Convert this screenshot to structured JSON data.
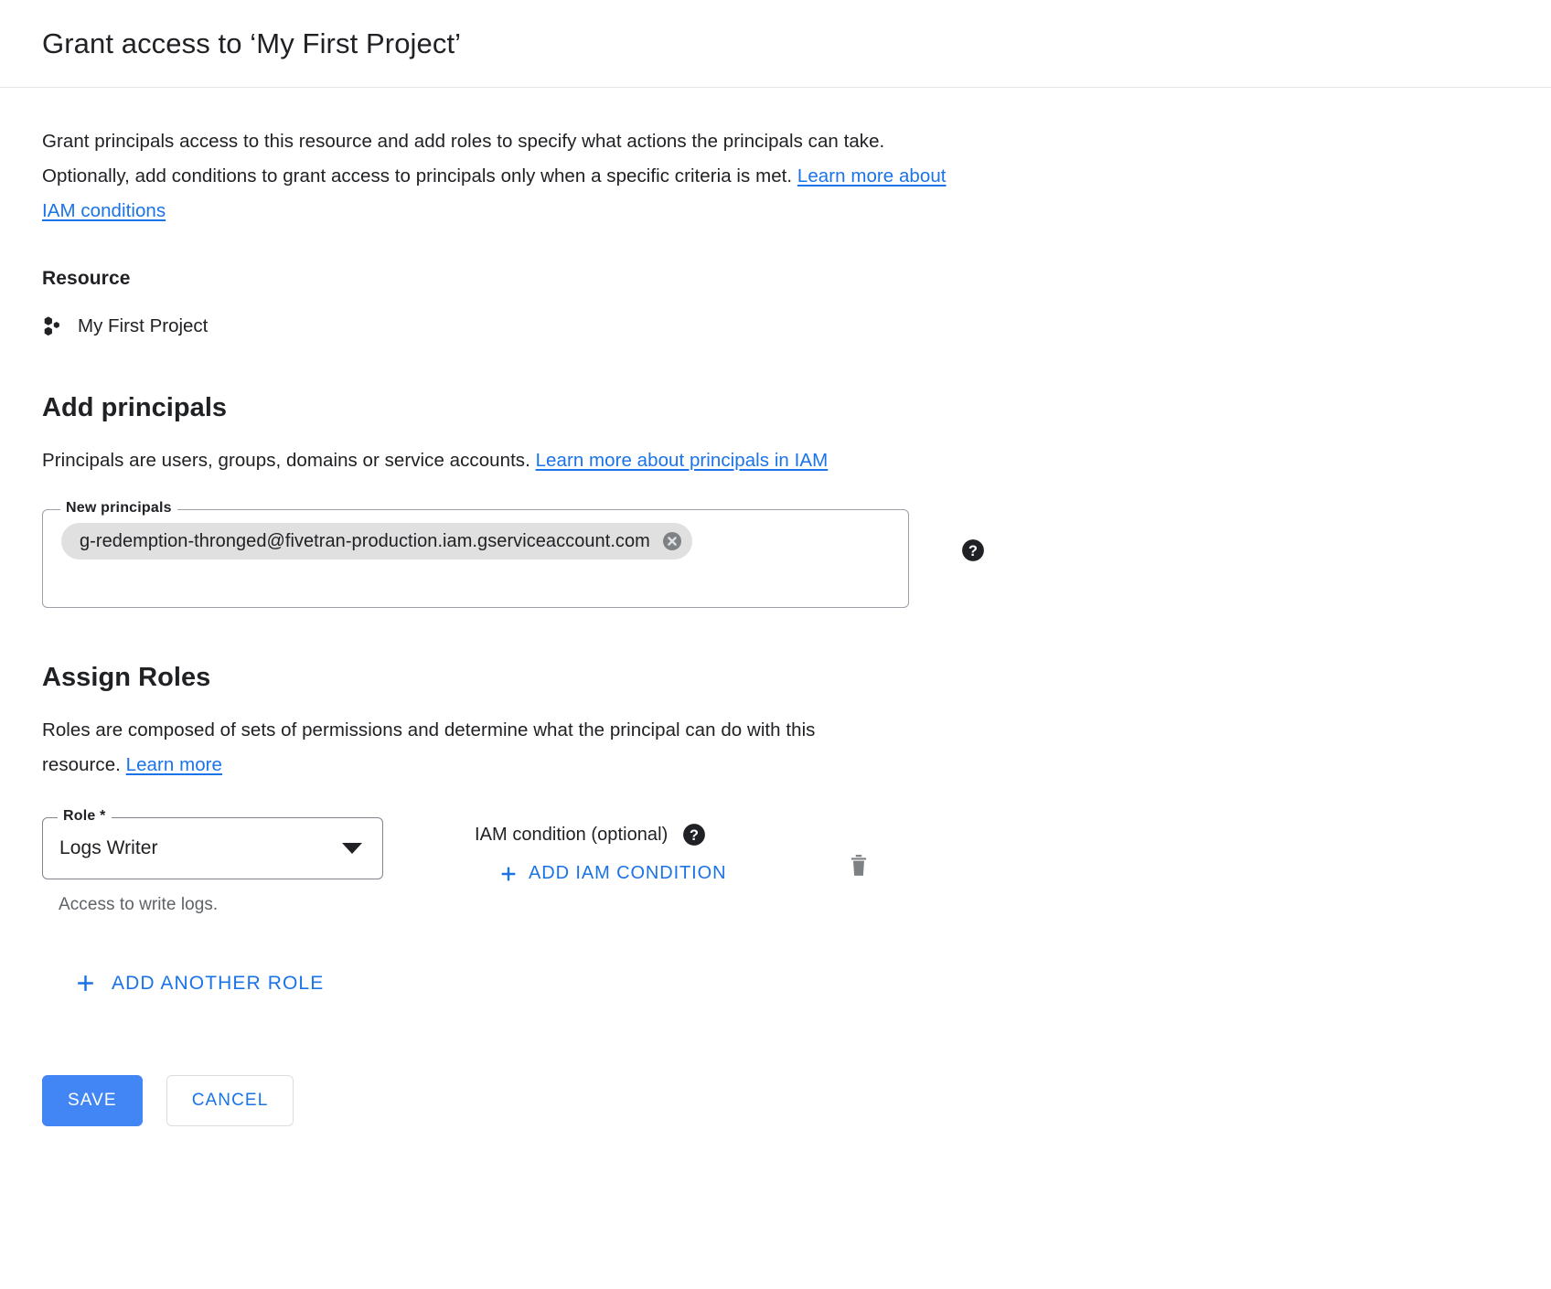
{
  "header": {
    "title": "Grant access to ‘My First Project’"
  },
  "intro": {
    "text": "Grant principals access to this resource and add roles to specify what actions the principals can take. Optionally, add conditions to grant access to principals only when a specific criteria is met.",
    "link_label": "Learn more about IAM conditions"
  },
  "resource": {
    "label": "Resource",
    "name": "My First Project",
    "icon": "project-icon"
  },
  "add_principals": {
    "heading": "Add principals",
    "description": "Principals are users, groups, domains or service accounts.",
    "link_label": "Learn more about principals in IAM",
    "field_legend": "New principals",
    "chips": [
      {
        "label": "g-redemption-thronged@fivetran-production.iam.gserviceaccount.com",
        "remove_icon": "close-circle-icon"
      }
    ],
    "help_icon": "help-icon"
  },
  "assign_roles": {
    "heading": "Assign Roles",
    "description": "Roles are composed of sets of permissions and determine what the principal can do with this resource.",
    "link_label": "Learn more",
    "role_field": {
      "legend": "Role *",
      "value": "Logs Writer",
      "helper": "Access to write logs.",
      "arrow_icon": "chevron-down-icon"
    },
    "condition": {
      "label": "IAM condition (optional)",
      "help_icon": "help-icon",
      "add_label": "ADD IAM CONDITION",
      "add_icon": "plus-icon"
    },
    "delete_icon": "trash-icon",
    "add_another_role": {
      "label": "ADD ANOTHER ROLE",
      "icon": "plus-icon"
    }
  },
  "actions": {
    "save_label": "SAVE",
    "cancel_label": "CANCEL"
  },
  "colors": {
    "link": "#1a73e8",
    "primary_button": "#4285f4",
    "chip_background": "#e0e0e0",
    "helper_text": "#5f6368"
  }
}
